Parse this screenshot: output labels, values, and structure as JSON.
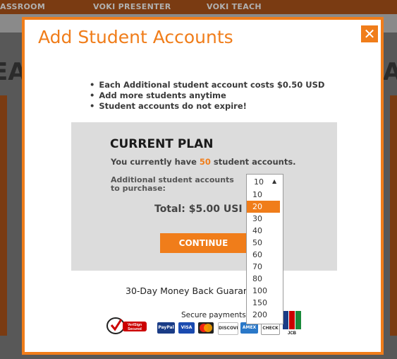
{
  "background": {
    "nav_items": [
      "ASSROOM",
      "VOKI PRESENTER",
      "VOKI TEACH"
    ],
    "big_left": "EA",
    "big_right": "A"
  },
  "modal": {
    "title": "Add Student Accounts",
    "close": "✕",
    "bullets": [
      "Each Additional student account costs $0.50 USD",
      "Add more students anytime",
      "Student accounts do not expire!"
    ],
    "plan": {
      "title": "CURRENT PLAN",
      "current_prefix": "You currently have ",
      "current_count": "50",
      "current_suffix": " student accounts.",
      "additional_line1": "Additional student accounts",
      "additional_line2": "to purchase:",
      "total": "Total: $5.00 USI",
      "continue": "CONTINUE"
    },
    "guarantee": "30-Day Money Back Guarar",
    "secure": "Secure payments",
    "badges": {
      "verisign": "VeriSign Secured",
      "cards": [
        "PayPal",
        "VISA",
        "MasterCard",
        "DISCOVER",
        "AMEX",
        "CHECK",
        "JCB"
      ]
    }
  },
  "dropdown": {
    "selected": "10",
    "highlighted": "20",
    "options": [
      "10",
      "20",
      "30",
      "40",
      "50",
      "60",
      "70",
      "80",
      "100",
      "150",
      "200"
    ]
  },
  "colors": {
    "accent": "#f07d1a",
    "panel": "#dcdcdc"
  }
}
